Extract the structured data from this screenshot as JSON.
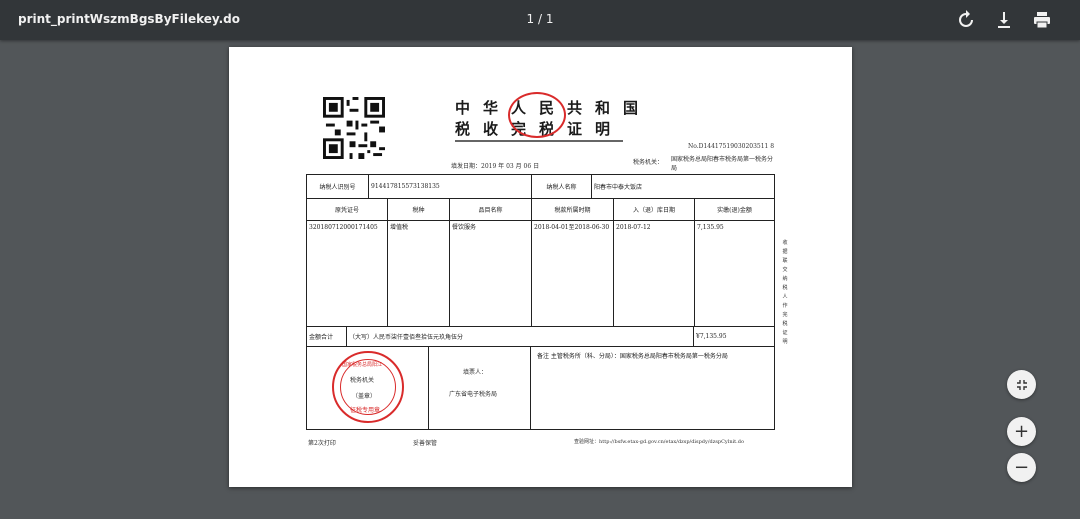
{
  "toolbar": {
    "filename": "print_printWszmBgsByFilekey.do",
    "page_indicator": "1 / 1",
    "rotate_icon": "rotate-icon",
    "download_icon": "download-icon",
    "print_icon": "print-icon"
  },
  "document": {
    "header_line1": "中华人民共和国",
    "header_line2": "税收完税证明",
    "doc_no": "No.D14417519030203511 8",
    "fill_date": "填发日期：2019 年 03 月 06 日",
    "tax_authority_label": "税务机关：",
    "tax_authority": "国家税务总局阳春市税务局第一税务分局",
    "taxpayer_id_label": "纳税人识别号",
    "taxpayer_id": "914417815573138135",
    "taxpayer_name_label": "纳税人名称",
    "taxpayer_name": "阳春市中泰大饭店",
    "columns": [
      "原凭证号",
      "税种",
      "品目名称",
      "税款所属时期",
      "入（退）库日期",
      "实缴(退)金额"
    ],
    "rows": [
      {
        "voucher": "320180712000171405",
        "tax_type": "增值税",
        "item": "餐饮服务",
        "period": "2018-04-01至2018-06-30",
        "storage_date": "2018-07-12",
        "amount": "7,135.95"
      }
    ],
    "total_label": "金额合计",
    "total_words": "（大写）人民币柒仟壹佰叁拾伍元玖角伍分",
    "total_amount": "¥7,135.95",
    "filler_label": "填票人：",
    "filler_name": "广东省电子税务局",
    "remark": "备注  主管税务所（科、分局）：国家税务总局阳春市税务局第一税务分局",
    "seal_top": "国家税务总局阳江",
    "seal_mid": "税务机关",
    "seal_stamp": "（盖章）",
    "seal_bottom": "征税专用章",
    "footer_left": "第2次打印",
    "footer_mid": "妥善保管",
    "footer_right": "查验网址：http://bsfw.etax-gd.gov.cn/etax/dzsp/dispdy/dzspCylnit.do",
    "side_note": "收据联 交纳税人作完税证明"
  },
  "controls": {
    "fit_icon": "fit-to-page-icon",
    "zoom_in": "+",
    "zoom_out": "−"
  }
}
